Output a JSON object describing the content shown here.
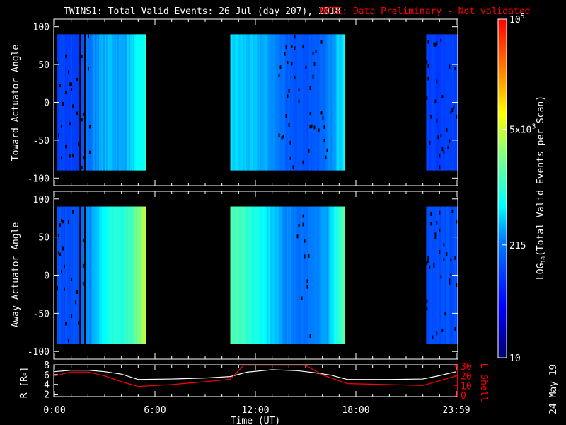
{
  "title": "TWINS1: Total Valid Events: 26 Jul (day 207), 2018",
  "note": "NOTE: Data Preliminary - Not validated",
  "date_stamp": "24 May 19",
  "colors": {
    "background": "#000000",
    "axes": "#ffffff",
    "note": "#ff0000",
    "r_line": "#ffffff",
    "lshell_line": "#ff0000"
  },
  "chart_data": [
    {
      "type": "heatmap",
      "ylabel": "Toward Actuator Angle",
      "ylim": [
        -110,
        110
      ],
      "yticks": [
        "100",
        "50",
        "0",
        "-50",
        "-100"
      ],
      "xlim_hours": [
        0,
        24
      ],
      "angle_range": [
        -90,
        90
      ],
      "bands": [
        {
          "start": 0.13,
          "end": 1.4,
          "levels": [
            2.0,
            2.0
          ]
        },
        {
          "start": 1.6,
          "end": 1.72,
          "levels": [
            2.2,
            2.2
          ]
        },
        {
          "start": 1.9,
          "end": 5.4,
          "levels": [
            2.3,
            2.5,
            2.6,
            2.5,
            2.7,
            2.9
          ]
        },
        {
          "start": 10.5,
          "end": 17.3,
          "levels": [
            2.7,
            2.6,
            2.5,
            2.2,
            2.1,
            2.3,
            2.8
          ]
        },
        {
          "start": 22.2,
          "end": 24.0,
          "levels": [
            2.0,
            2.0
          ]
        }
      ]
    },
    {
      "type": "heatmap",
      "ylabel": "Away Actuator Angle",
      "ylim": [
        -110,
        110
      ],
      "yticks": [
        "100",
        "50",
        "0",
        "-50",
        "-100"
      ],
      "xlim_hours": [
        0,
        24
      ],
      "angle_range": [
        -90,
        90
      ],
      "bands": [
        {
          "start": 0.13,
          "end": 1.4,
          "levels": [
            2.1,
            2.1
          ]
        },
        {
          "start": 1.6,
          "end": 1.72,
          "levels": [
            2.3,
            2.3
          ]
        },
        {
          "start": 1.9,
          "end": 5.4,
          "levels": [
            2.4,
            2.7,
            2.9,
            3.0,
            3.2,
            3.6
          ]
        },
        {
          "start": 10.5,
          "end": 17.3,
          "levels": [
            3.2,
            3.0,
            2.7,
            2.4,
            2.3,
            2.5,
            3.2
          ]
        },
        {
          "start": 22.2,
          "end": 24.0,
          "levels": [
            2.1,
            2.1
          ]
        }
      ]
    },
    {
      "type": "line",
      "xlabel": "Time (UT)",
      "xticks": [
        "0:00",
        "6:00",
        "12:00",
        "18:00",
        "23:59"
      ],
      "ylabel": "R [RE]",
      "ylabel_main": "R [R",
      "ylabel_sub": "E",
      "ylabel_end": "]",
      "ylim": [
        1.5,
        8
      ],
      "yticks": [
        "2",
        "4",
        "6",
        "8"
      ],
      "y2label": "L Shell",
      "y2lim": [
        0,
        30
      ],
      "y2ticks": [
        "0",
        "10",
        "20",
        "30"
      ],
      "series": [
        {
          "axis": "left",
          "x": [
            0,
            1,
            2,
            3,
            4,
            5,
            7,
            9,
            10.5,
            11.5,
            13,
            14.5,
            15.5,
            16.5,
            17.5,
            20,
            22,
            23,
            24
          ],
          "y": [
            6.6,
            6.9,
            6.9,
            6.6,
            6.1,
            5.0,
            5.1,
            5.3,
            5.6,
            6.5,
            7.0,
            6.8,
            6.4,
            5.9,
            5.0,
            5.0,
            5.1,
            5.8,
            6.6
          ]
        },
        {
          "axis": "right",
          "x": [
            0,
            1,
            2,
            3,
            4,
            5,
            7,
            9,
            10.5,
            11.3,
            15.0,
            16,
            17.5,
            20,
            22,
            24
          ],
          "y": [
            20,
            24,
            24,
            20,
            14,
            9,
            11,
            14,
            16.5,
            31,
            31,
            21,
            12,
            11,
            10,
            20
          ]
        }
      ]
    }
  ],
  "colorbar": {
    "label_main": "LOG",
    "label_sub": "10",
    "label_rest": "(Total Valid Events per Scan)",
    "range_log10": [
      1,
      5
    ],
    "ticks": [
      {
        "value": 10,
        "text": "10"
      },
      {
        "value": 215,
        "text": "215"
      },
      {
        "value": 5000,
        "text": "5x10",
        "exp": "3"
      },
      {
        "value": 100000,
        "text": "10",
        "exp": "5"
      }
    ]
  }
}
